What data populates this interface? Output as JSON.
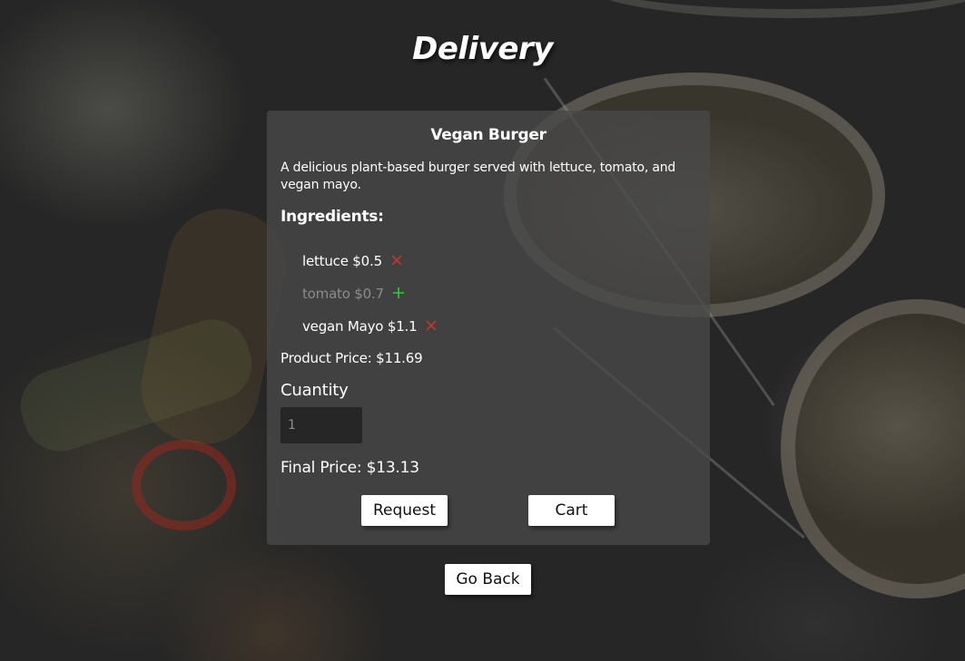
{
  "page": {
    "title": "Delivery"
  },
  "product": {
    "name": "Vegan Burger",
    "description": "A delicious plant-based burger served with lettuce, tomato, and vegan mayo.",
    "ingredients_heading": "Ingredients:",
    "ingredients": [
      {
        "label": "lettuce $0.5",
        "included": true,
        "action_icon": "remove-icon"
      },
      {
        "label": "tomato $0.7",
        "included": false,
        "action_icon": "add-icon"
      },
      {
        "label": "vegan Mayo $1.1",
        "included": true,
        "action_icon": "remove-icon"
      }
    ],
    "product_price": "Product Price: $11.69",
    "quantity_label": "Cuantity",
    "quantity_value": "1",
    "final_price": "Final Price: $13.13"
  },
  "actions": {
    "request_label": "Request",
    "cart_label": "Cart",
    "back_label": "Go Back"
  },
  "colors": {
    "remove_icon": "#c0392b",
    "add_icon": "#2ecc40",
    "card_background": "#484848",
    "excluded_text": "#8c8c8c"
  }
}
